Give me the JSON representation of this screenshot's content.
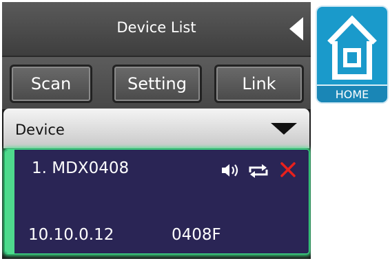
{
  "header": {
    "title": "Device List",
    "back_icon": "back-triangle-icon"
  },
  "toolbar": {
    "buttons": [
      {
        "label": "Scan"
      },
      {
        "label": "Setting"
      },
      {
        "label": "Link"
      }
    ]
  },
  "device_section": {
    "label": "Device",
    "toggle_icon": "dropdown-triangle-icon"
  },
  "device_card": {
    "name": "1. MDX0408",
    "ip": "10.10.0.12",
    "code": "0408F",
    "icons": [
      "speaker-icon",
      "repeat-icon",
      "close-icon"
    ],
    "accent_color": "#4fd98d",
    "background_color": "#2a2555"
  },
  "home": {
    "label": "HOME",
    "icon": "house-icon",
    "color": "#1a9acb"
  }
}
